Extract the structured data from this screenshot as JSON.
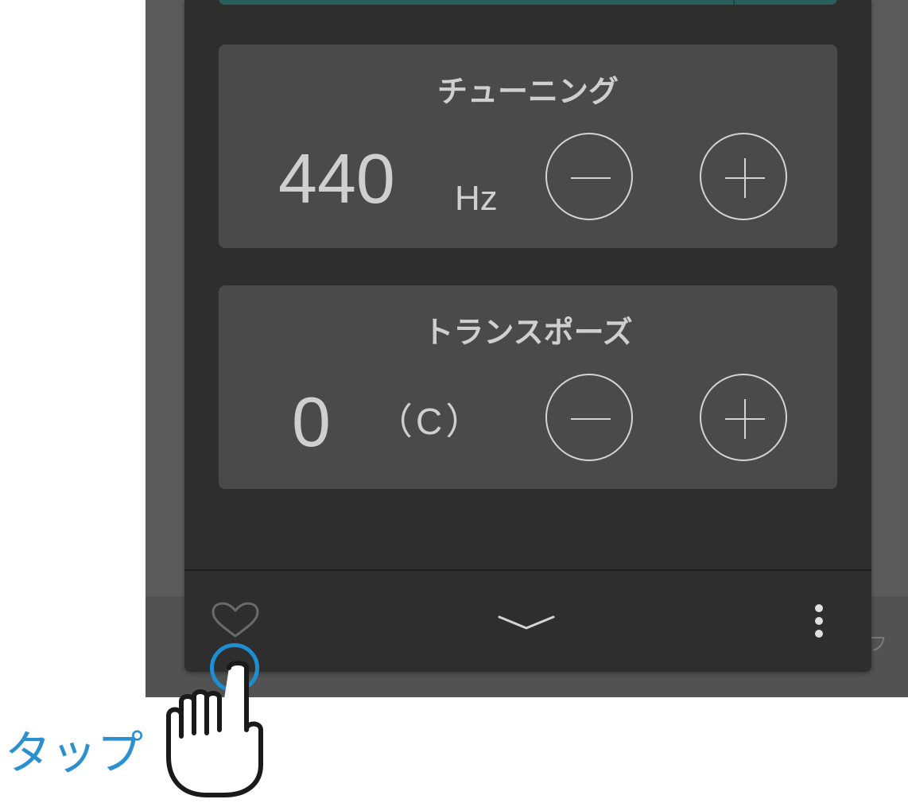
{
  "tuning": {
    "title": "チューニング",
    "value": "440",
    "unit": "Hz"
  },
  "transpose": {
    "title": "トランスポーズ",
    "value": "0",
    "key": "（C）"
  },
  "background_hint": "フ",
  "annotation": {
    "tap_label": "タップ"
  },
  "icons": {
    "tuning_minus": "minus-icon",
    "tuning_plus": "plus-icon",
    "transpose_minus": "minus-icon",
    "transpose_plus": "plus-icon",
    "favorite": "heart-icon",
    "collapse": "chevron-down-icon",
    "more": "more-vertical-icon",
    "hand": "tap-hand-icon"
  },
  "colors": {
    "panel": "#2e2e2e",
    "card": "#4a4a4a",
    "accent_strip": "#2b5f5c",
    "tap_highlight": "#1c8ed1"
  }
}
